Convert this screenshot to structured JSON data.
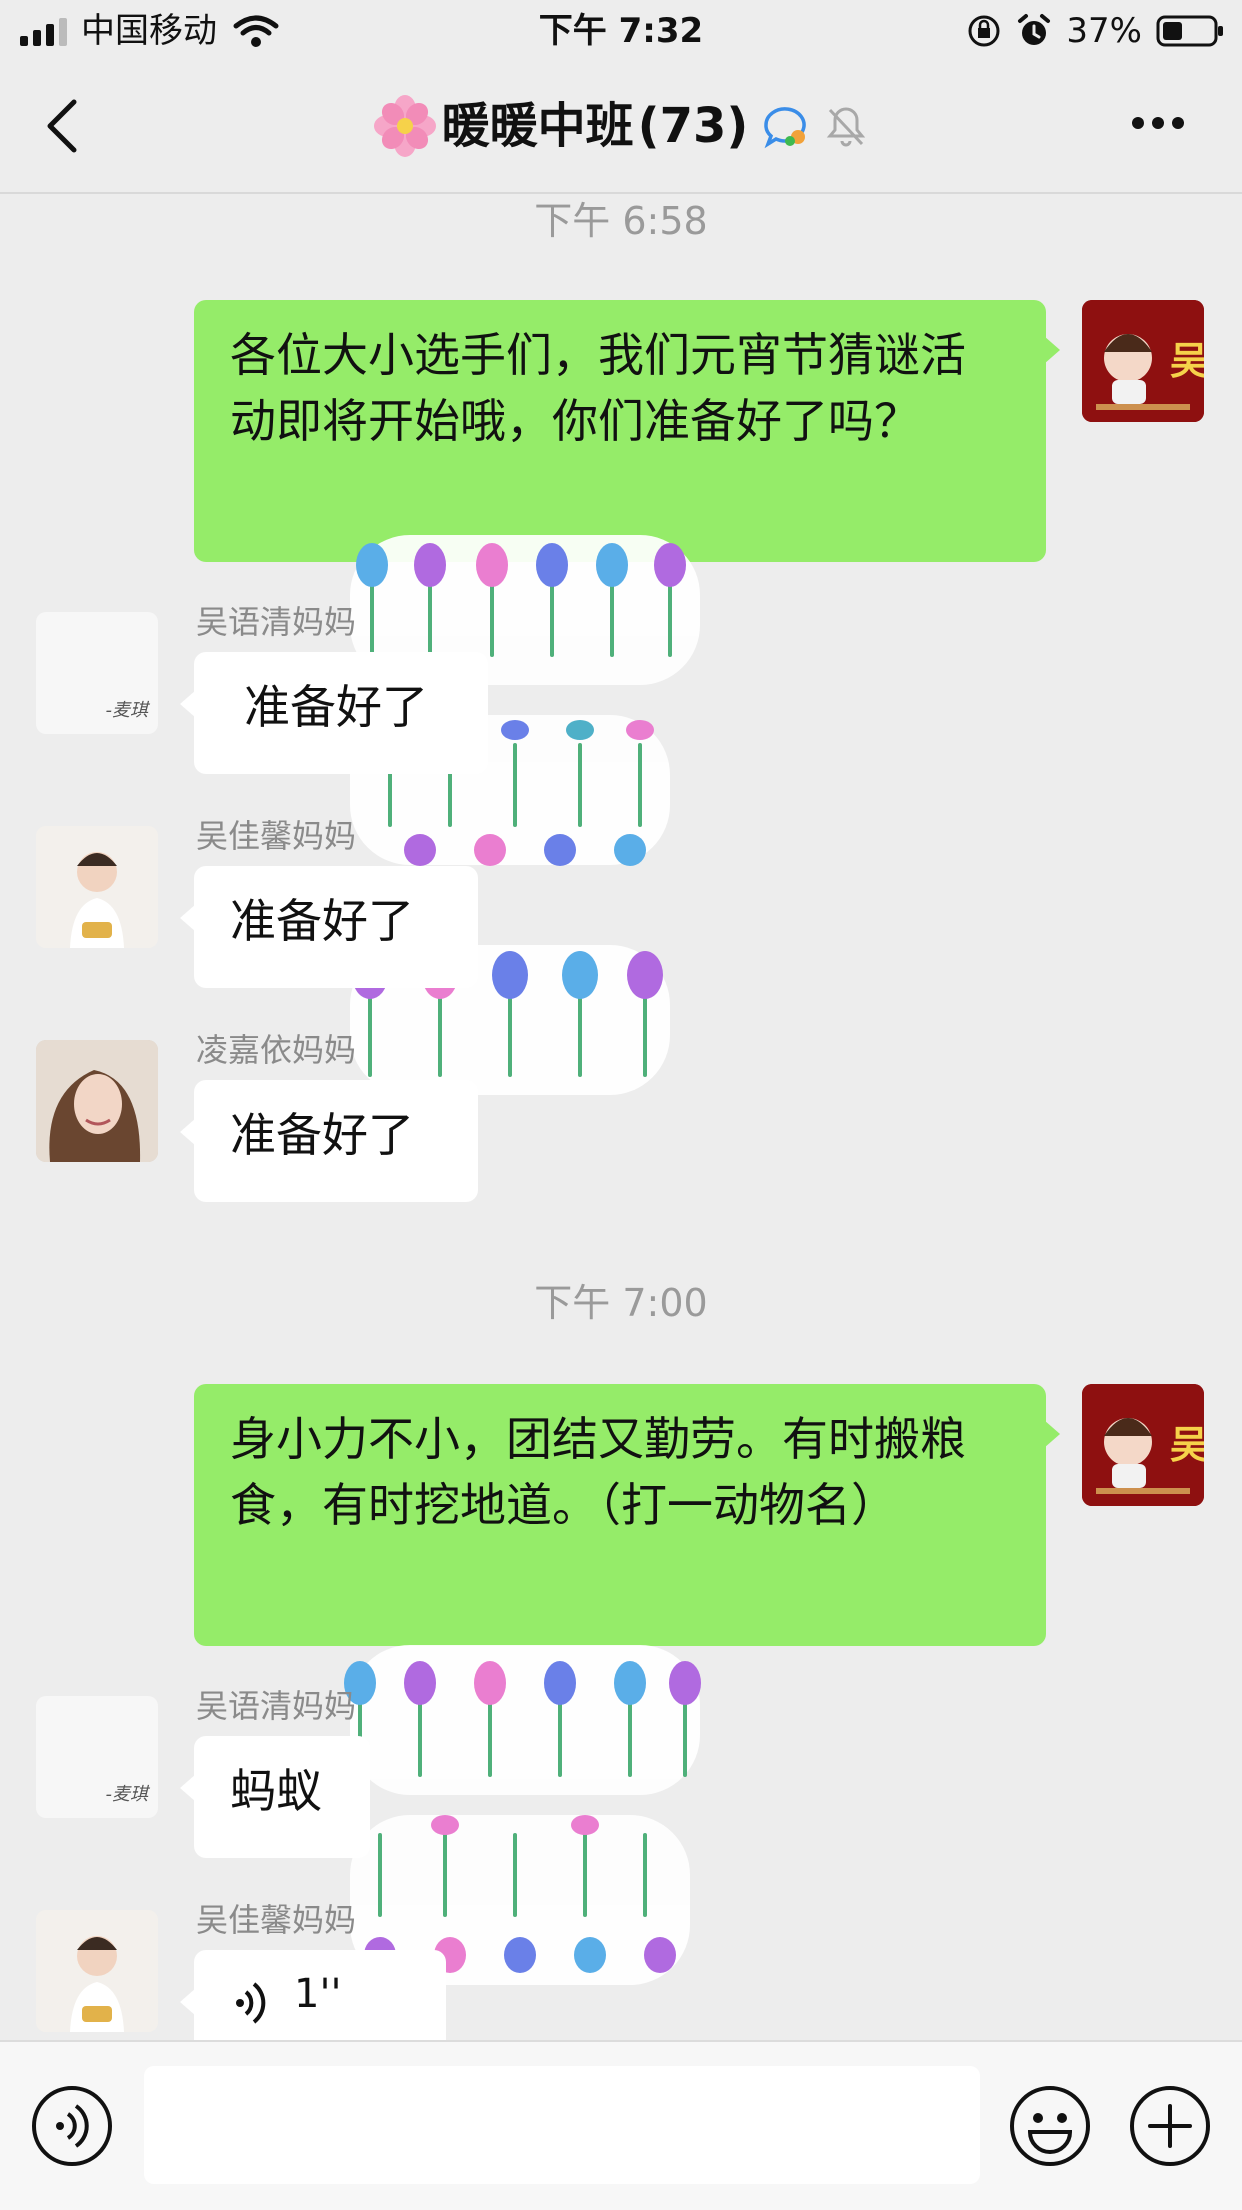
{
  "status_bar": {
    "carrier": "中国移动",
    "time": "下午 7:32",
    "battery": "37%"
  },
  "nav": {
    "title": "暖暖中班",
    "member_count": "(73)"
  },
  "messages": {
    "ts1": "下午 6:58",
    "m1_text": "各位大小选手们，我们元宵节猜谜活动即将开始哦，你们准备好了吗？",
    "m2_sender": "吴语清妈妈",
    "m2_text": "准备好了",
    "m3_sender": "吴佳馨妈妈",
    "m3_text": "准备好了",
    "m4_sender": "凌嘉依妈妈",
    "m4_text": "准备好了",
    "ts2": "下午 7:00",
    "m5_text": "身小力不小，团结又勤劳。有时搬粮食，有时挖地道。（打一动物名）",
    "m6_sender": "吴语清妈妈",
    "m6_text": "蚂蚁",
    "m7_sender": "吴佳馨妈妈",
    "m7_voice": "1''"
  },
  "avatars": {
    "self_seal_text": "吴",
    "plain_signature": "-麦琪"
  },
  "colors": {
    "background": "#ededed",
    "outgoing_bubble": "#95ec69",
    "incoming_bubble": "#ffffff",
    "timestamp": "#9a9a9a"
  },
  "icons": [
    "back-icon",
    "flower-icon",
    "group-badge-icon",
    "mute-icon",
    "more-icon",
    "voice-icon",
    "emoji-icon",
    "plus-icon",
    "tulip-sticker"
  ]
}
